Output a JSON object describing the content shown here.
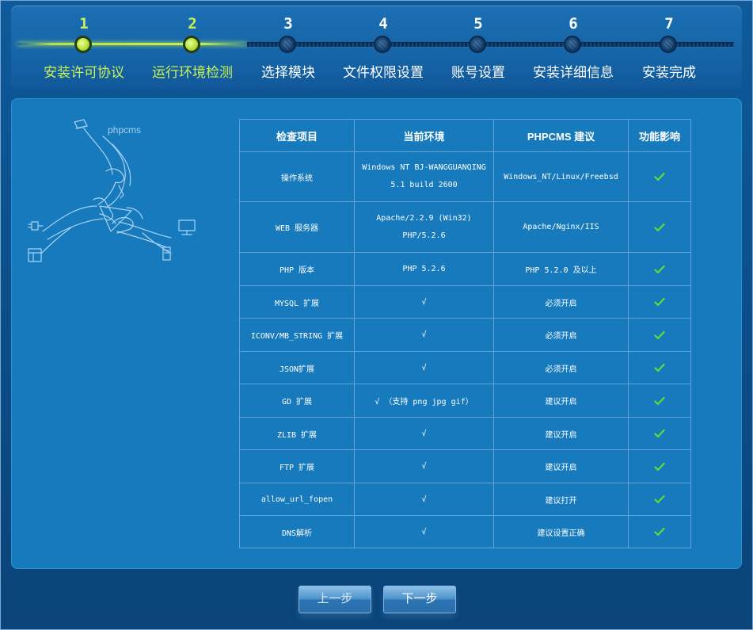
{
  "steps": [
    {
      "num": "1",
      "label": "安装许可协议",
      "state": "done"
    },
    {
      "num": "2",
      "label": "运行环境检测",
      "state": "done"
    },
    {
      "num": "3",
      "label": "选择模块",
      "state": "todo"
    },
    {
      "num": "4",
      "label": "文件权限设置",
      "state": "todo"
    },
    {
      "num": "5",
      "label": "账号设置",
      "state": "todo"
    },
    {
      "num": "6",
      "label": "安装详细信息",
      "state": "todo"
    },
    {
      "num": "7",
      "label": "安装完成",
      "state": "todo"
    }
  ],
  "illustration": {
    "text": "phpcms"
  },
  "table": {
    "headers": [
      "检查项目",
      "当前环境",
      "PHPCMS 建议",
      "功能影响"
    ],
    "rows": [
      {
        "item": "操作系统",
        "env1": "Windows NT BJ-WANGGUANQING",
        "env2": "5.1 build 2600",
        "advice": "Windows_NT/Linux/Freebsd",
        "impact": "ok"
      },
      {
        "item": "WEB 服务器",
        "env1": "Apache/2.2.9 (Win32)",
        "env2": "PHP/5.2.6",
        "advice": "Apache/Nginx/IIS",
        "impact": "ok"
      },
      {
        "item": "PHP 版本",
        "env1": "PHP 5.2.6",
        "env2": "",
        "advice": "PHP 5.2.0 及以上",
        "impact": "ok"
      },
      {
        "item": "MYSQL 扩展",
        "env1": "√",
        "env2": "",
        "advice": "必须开启",
        "impact": "ok"
      },
      {
        "item": "ICONV/MB_STRING 扩展",
        "env1": "√",
        "env2": "",
        "advice": "必须开启",
        "impact": "ok"
      },
      {
        "item": "JSON扩展",
        "env1": "√",
        "env2": "",
        "advice": "必须开启",
        "impact": "ok"
      },
      {
        "item": "GD 扩展",
        "env1": "√ （支持 png jpg gif）",
        "env2": "",
        "advice": "建议开启",
        "impact": "ok"
      },
      {
        "item": "ZLIB 扩展",
        "env1": "√",
        "env2": "",
        "advice": "建议开启",
        "impact": "ok"
      },
      {
        "item": "FTP 扩展",
        "env1": "√",
        "env2": "",
        "advice": "建议开启",
        "impact": "ok"
      },
      {
        "item": "allow_url_fopen",
        "env1": "√",
        "env2": "",
        "advice": "建议打开",
        "impact": "ok"
      },
      {
        "item": "DNS解析",
        "env1": "√",
        "env2": "",
        "advice": "建议设置正确",
        "impact": "ok"
      }
    ]
  },
  "buttons": {
    "prev": "上一步",
    "next": "下一步"
  },
  "colors": {
    "done": "#c9f25a",
    "todo": "#ffffff",
    "check": "#5fdc3a"
  }
}
